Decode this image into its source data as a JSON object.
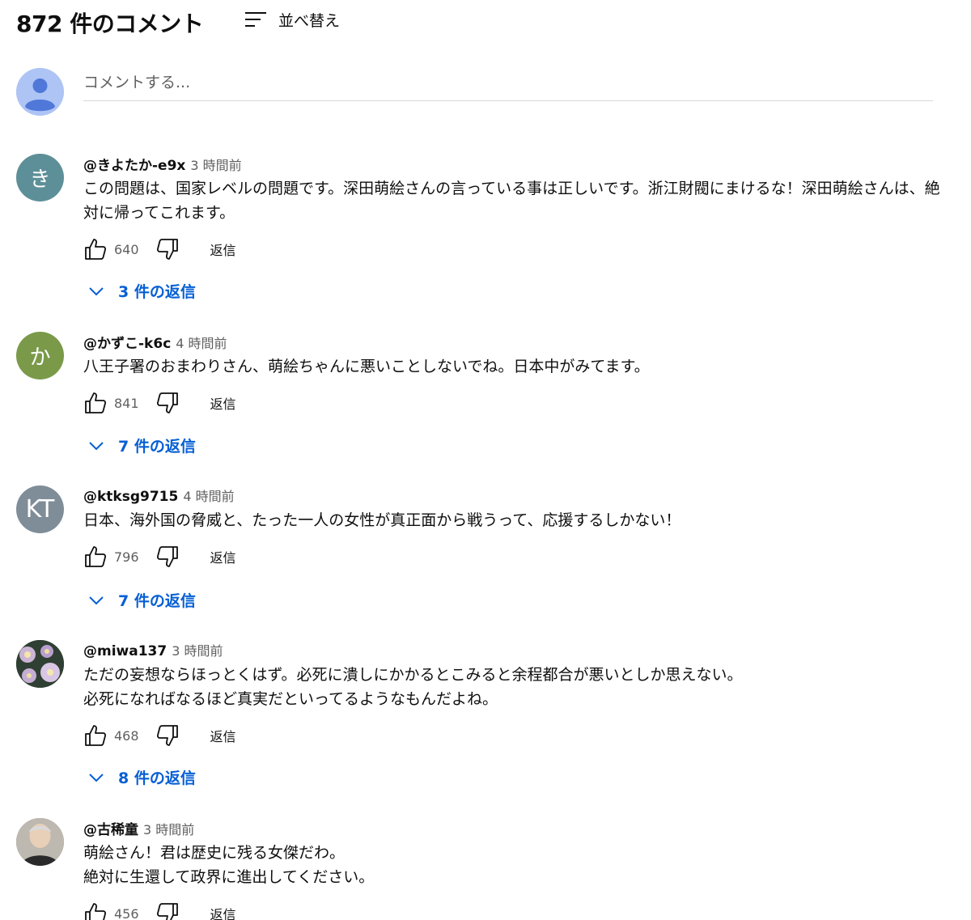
{
  "header": {
    "title": "872 件のコメント",
    "sort_label": "並べ替え"
  },
  "compose": {
    "placeholder": "コメントする..."
  },
  "comments": [
    {
      "author": "@きよたか-e9x",
      "time": "3 時間前",
      "avatar_text": "き",
      "avatar_color": "#5d8f98",
      "text": "この問題は、国家レベルの問題です。深田萌絵さんの言っている事は正しいです。浙江財閥にまけるな！深田萌絵さんは、絶対に帰ってこれます。",
      "likes": "640",
      "reply_label": "返信",
      "replies_label": "3 件の返信"
    },
    {
      "author": "@かずこ-k6c",
      "time": "4 時間前",
      "avatar_text": "か",
      "avatar_color": "#7a9a4a",
      "text": "八王子署のおまわりさん、萌絵ちゃんに悪いことしないでね。日本中がみてます。",
      "likes": "841",
      "reply_label": "返信",
      "replies_label": "7 件の返信"
    },
    {
      "author": "@ktksg9715",
      "time": "4 時間前",
      "avatar_text": "KT",
      "avatar_color": "#7f8d99",
      "text": "日本、海外国の脅威と、たった一人の女性が真正面から戦うって、応援するしかない！",
      "likes": "796",
      "reply_label": "返信",
      "replies_label": "7 件の返信"
    },
    {
      "author": "@miwa137",
      "time": "3 時間前",
      "avatar_text": "",
      "avatar_color": "#3a4a3a",
      "text_lines": [
        "ただの妄想ならほっとくはず。必死に潰しにかかるとこみると余程都合が悪いとしか思えない。",
        "必死になればなるほど真実だといってるようなもんだよね。"
      ],
      "likes": "468",
      "reply_label": "返信",
      "replies_label": "8 件の返信"
    },
    {
      "author": "@古稀童",
      "time": "3 時間前",
      "avatar_text": "",
      "avatar_color": "#8a8a8a",
      "text_lines": [
        "萌絵さん！君は歴史に残る女傑だわ。",
        "絶対に生還して政界に進出してください。"
      ],
      "likes": "456",
      "reply_label": "返信"
    }
  ],
  "colors": {
    "link": "#065fd4",
    "secondary_text": "#606060",
    "primary_text": "#0f0f0f"
  },
  "icons": {
    "sort": "sort-lines-icon",
    "like": "thumbs-up-icon",
    "dislike": "thumbs-down-icon",
    "chevron": "chevron-down-icon",
    "my_avatar": "user-silhouette-icon"
  }
}
